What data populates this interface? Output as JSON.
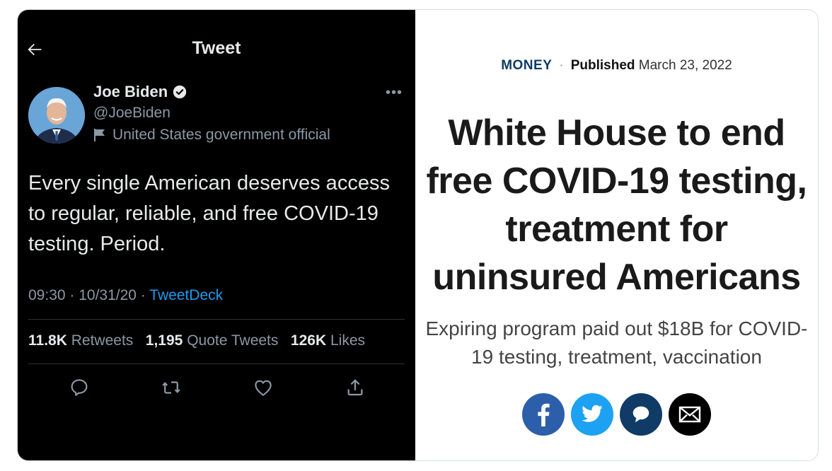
{
  "tweet": {
    "header_title": "Tweet",
    "author": {
      "name": "Joe Biden",
      "handle": "@JoeBiden",
      "label": "United States government official"
    },
    "text": "Every single American deserves access to regular, reliable, and free COVID-19 testing. Period.",
    "time": "09:30",
    "date": "10/31/20",
    "source": "TweetDeck",
    "stats": {
      "retweets_count": "11.8K",
      "retweets_label": "Retweets",
      "quotes_count": "1,195",
      "quotes_label": "Quote Tweets",
      "likes_count": "126K",
      "likes_label": "Likes"
    },
    "icons": [
      "back-arrow-icon",
      "verified-icon",
      "flag-icon",
      "more-icon",
      "reply-icon",
      "retweet-icon",
      "like-icon",
      "share-icon"
    ]
  },
  "article": {
    "section": "MONEY",
    "published_label": "Published",
    "published_date": "March 23, 2022",
    "headline": "White House to end free COVID-19 testing, treatment for uninsured Americans",
    "subhead": "Expiring program paid out $18B for COVID-19 testing, treatment, vaccination",
    "share_icons": [
      "facebook-icon",
      "twitter-icon",
      "comment-icon",
      "email-icon"
    ]
  },
  "colors": {
    "tweet_bg": "#000000",
    "link_blue": "#1d9bf0",
    "section_navy": "#0f3b66",
    "facebook_blue": "#2d5ea9",
    "twitter_blue": "#1da1f2"
  }
}
